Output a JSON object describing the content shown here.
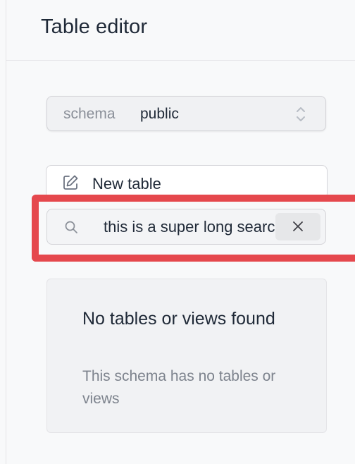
{
  "header": {
    "title": "Table editor"
  },
  "schema_selector": {
    "label": "schema",
    "value": "public",
    "icon": "chevron-up-down-icon"
  },
  "new_table": {
    "label": "New table",
    "icon": "edit-icon"
  },
  "search": {
    "value": "this is a super long search",
    "icon": "search-icon",
    "clear_icon": "close-icon"
  },
  "empty_state": {
    "title": "No tables or views found",
    "description": "This schema has no tables or views"
  },
  "colors": {
    "highlight": "#e5484d",
    "background": "#f8f9fa"
  }
}
